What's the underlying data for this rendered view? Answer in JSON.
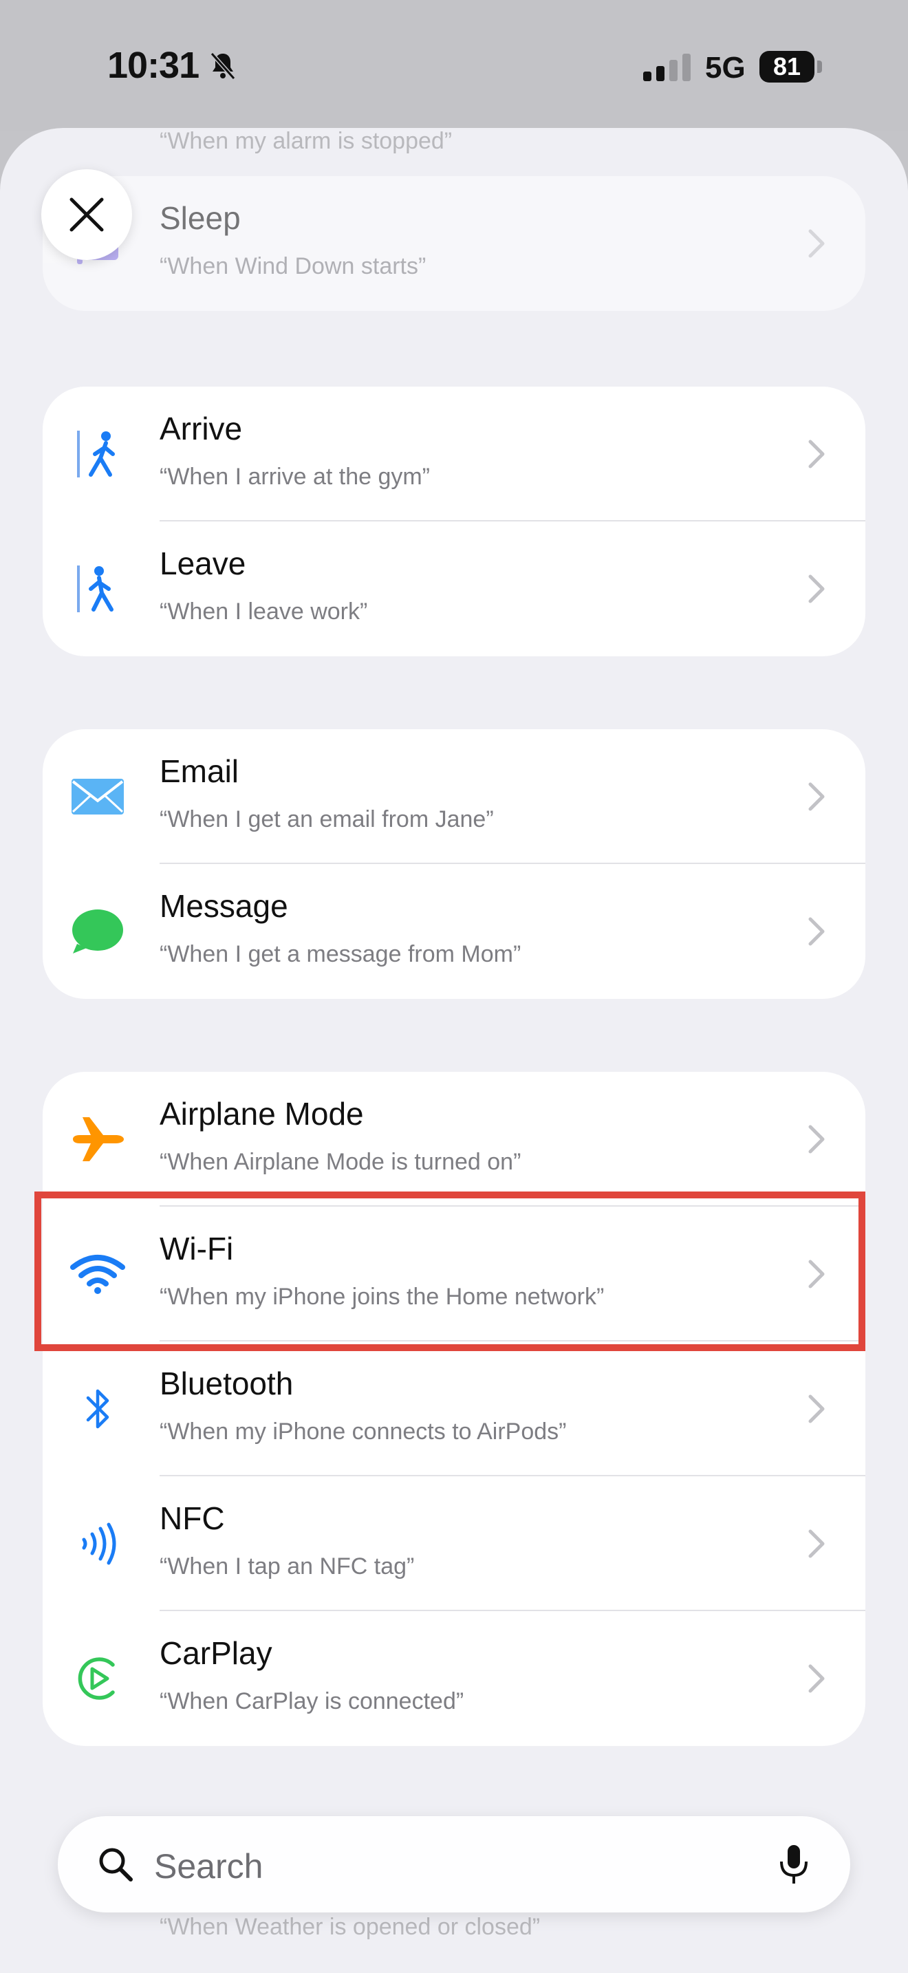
{
  "status_bar": {
    "time": "10:31",
    "network": "5G",
    "battery": "81"
  },
  "ghost": {
    "top_text": "“When my alarm is stopped”",
    "bottom_text": "“When Weather is opened or closed”"
  },
  "groups": [
    {
      "rows": [
        {
          "icon": "bed-icon",
          "title": "Sleep",
          "subtitle": "“When Wind Down starts”"
        }
      ]
    },
    {
      "rows": [
        {
          "icon": "arrive-icon",
          "title": "Arrive",
          "subtitle": "“When I arrive at the gym”"
        },
        {
          "icon": "leave-icon",
          "title": "Leave",
          "subtitle": "“When I leave work”"
        }
      ]
    },
    {
      "rows": [
        {
          "icon": "email-icon",
          "title": "Email",
          "subtitle": "“When I get an email from Jane”"
        },
        {
          "icon": "message-icon",
          "title": "Message",
          "subtitle": "“When I get a message from Mom”"
        }
      ]
    },
    {
      "rows": [
        {
          "icon": "airplane-icon",
          "title": "Airplane Mode",
          "subtitle": "“When Airplane Mode is turned on”"
        },
        {
          "icon": "wifi-icon",
          "title": "Wi-Fi",
          "subtitle": "“When my iPhone joins the Home network”"
        },
        {
          "icon": "bluetooth-icon",
          "title": "Bluetooth",
          "subtitle": "“When my iPhone connects to AirPods”"
        },
        {
          "icon": "nfc-icon",
          "title": "NFC",
          "subtitle": "“When I tap an NFC tag”"
        },
        {
          "icon": "carplay-icon",
          "title": "CarPlay",
          "subtitle": "“When CarPlay is connected”"
        }
      ]
    }
  ],
  "search": {
    "placeholder": "Search"
  },
  "colors": {
    "highlight": "#e0463c",
    "blue": "#1a7cf5",
    "green": "#34c759",
    "orange": "#ff9500",
    "purple": "#8e7cf0"
  }
}
